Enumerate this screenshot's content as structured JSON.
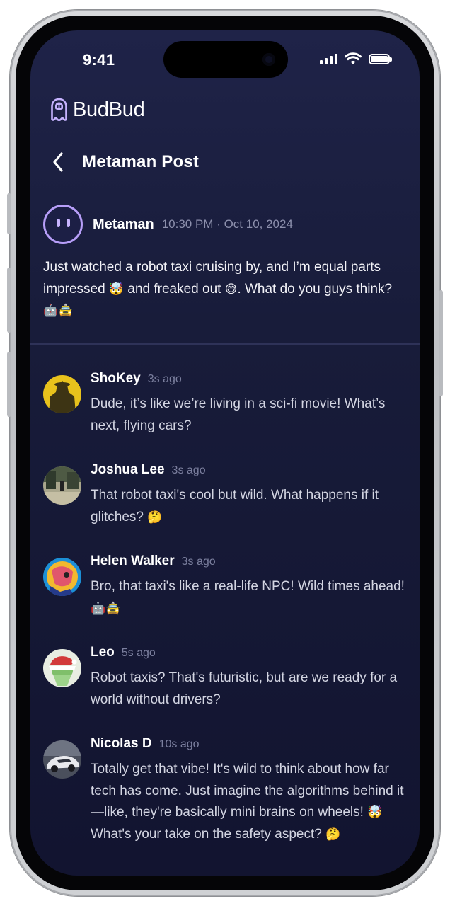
{
  "status_bar": {
    "time": "9:41",
    "icons": [
      "signal-icon",
      "wifi-icon",
      "battery-icon"
    ]
  },
  "brand": {
    "name": "BudBud",
    "logo_icon": "budbud-logo-icon",
    "accent_color": "#c6b3ff"
  },
  "nav": {
    "back_icon": "chevron-left-icon",
    "title": "Metaman Post"
  },
  "post": {
    "author": "Metaman",
    "timestamp": "10:30 PM · Oct 10, 2024",
    "text_part1": "Just watched a robot taxi cruising by, and I’m equal parts impressed ",
    "emoji1": "🤯",
    "text_part2": " and freaked out ",
    "emoji2": "😅",
    "text_part3": ". What do you guys think? ",
    "emoji3": "🤖🚖"
  },
  "comments": [
    {
      "name": "ShoKey",
      "time": "3s ago",
      "text": "Dude, it’s like we’re living in a sci-fi movie! What’s next, flying cars?",
      "emoji": "",
      "avatar_color": "#e8c21c"
    },
    {
      "name": "Joshua Lee",
      "time": "3s ago",
      "text": "That robot taxi's cool but wild. What happens if it glitches? ",
      "emoji": "🤔",
      "avatar_color": "#6f7a5c"
    },
    {
      "name": "Helen Walker",
      "time": "3s ago",
      "text": "Bro, that taxi's like a real-life NPC! Wild times ahead! ",
      "emoji": "🤖🚖",
      "avatar_color": "#1c8fd6"
    },
    {
      "name": "Leo",
      "time": "5s ago",
      "text": "Robot taxis? That's futuristic, but are we ready for a world without drivers?",
      "emoji": "",
      "avatar_color": "#9ccf8e"
    },
    {
      "name": "Nicolas D",
      "time": "10s ago",
      "text_part1": "Totally get that vibe! It's wild to think about how far tech has come. Just imagine the algorithms behind it—like, they're basically mini brains on wheels! ",
      "emoji1": "🤯",
      "text_part2": " What's your take on the safety aspect? ",
      "emoji2": "🤔",
      "avatar_color": "#5d6270"
    }
  ]
}
